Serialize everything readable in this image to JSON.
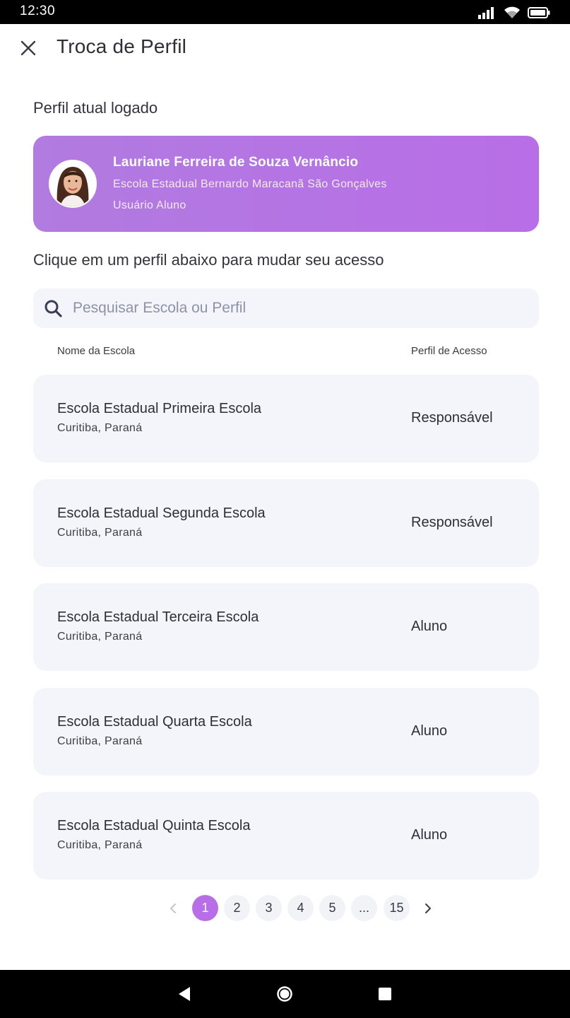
{
  "status_bar": {
    "time": "12:30",
    "icons": [
      "signal-icon",
      "wifi-icon",
      "battery-icon"
    ]
  },
  "header": {
    "title": "Troca de Perfil",
    "close_icon": "close-icon"
  },
  "current_profile": {
    "section_label": "Perfil atual logado",
    "name": "Lauriane Ferreira de Souza Vernâncio",
    "school": "Escola Estadual Bernardo Maracanã São Gonçalves",
    "role": "Usuário Aluno",
    "card_color": "#b86ee6"
  },
  "switch_section": {
    "label": "Clique em um perfil abaixo para mudar seu acesso",
    "search_placeholder": "Pesquisar Escola ou Perfil",
    "search_value": ""
  },
  "table": {
    "columns": [
      "Nome da Escola",
      "Perfil de Acesso"
    ],
    "rows": [
      {
        "school": "Escola Estadual Primeira Escola",
        "city": "Curitiba, Paraná",
        "profile": "Responsável"
      },
      {
        "school": "Escola Estadual Segunda Escola",
        "city": "Curitiba, Paraná",
        "profile": "Responsável"
      },
      {
        "school": "Escola Estadual Terceira Escola",
        "city": "Curitiba, Paraná",
        "profile": "Aluno"
      },
      {
        "school": "Escola Estadual Quarta Escola",
        "city": "Curitiba, Paraná",
        "profile": "Aluno"
      },
      {
        "school": "Escola Estadual Quinta Escola",
        "city": "Curitiba, Paraná",
        "profile": "Aluno"
      }
    ]
  },
  "pagination": {
    "pages": [
      "1",
      "2",
      "3",
      "4",
      "5",
      "...",
      "15"
    ],
    "current": "1"
  },
  "colors": {
    "accent": "#b86ee6",
    "row_background": "#f4f5fa"
  }
}
